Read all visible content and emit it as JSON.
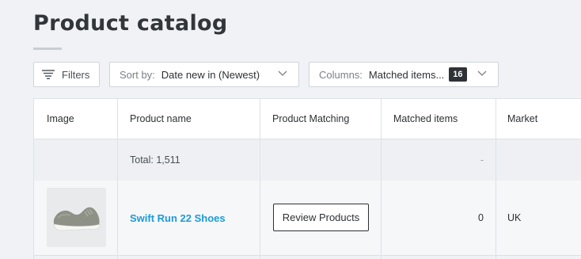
{
  "page": {
    "title": "Product catalog"
  },
  "toolbar": {
    "filters_label": "Filters",
    "sort_label": "Sort by:",
    "sort_value": "Date new in (Newest)",
    "columns_label": "Columns:",
    "columns_value": "Matched items...",
    "columns_count": "16"
  },
  "table": {
    "headers": [
      "Image",
      "Product name",
      "Product Matching",
      "Matched items",
      "Market"
    ],
    "summary": {
      "total": "Total: 1,511",
      "matched": "-"
    },
    "rows": [
      {
        "image_icon": "shoe-image",
        "product_name": "Swift Run 22 Shoes",
        "action_label": "Review Products",
        "matched_items": "0",
        "market": "UK"
      }
    ]
  },
  "colors": {
    "link": "#1d9bd8",
    "badge": "#2f3236",
    "background": "#f0f2f5"
  }
}
